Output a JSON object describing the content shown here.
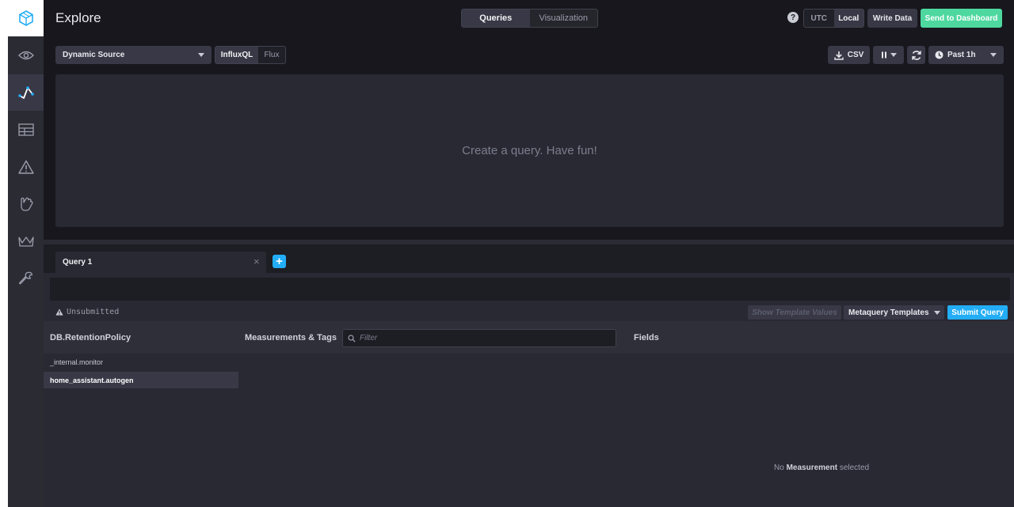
{
  "app": {
    "title": "Explore"
  },
  "sidebar": {
    "items": [
      {
        "name": "eye-icon",
        "active": false
      },
      {
        "name": "graph-icon",
        "active": true
      },
      {
        "name": "dashboard-icon",
        "active": false
      },
      {
        "name": "alert-icon",
        "active": false
      },
      {
        "name": "hand-icon",
        "active": false
      },
      {
        "name": "crown-icon",
        "active": false
      },
      {
        "name": "wrench-icon",
        "active": false
      }
    ]
  },
  "header": {
    "view_tabs": [
      "Queries",
      "Visualization"
    ],
    "active_view": "Queries",
    "help": "?",
    "timezone": [
      "UTC",
      "Local"
    ],
    "active_timezone": "Local",
    "write_data": "Write Data",
    "send_to_dashboard": "Send to Dashboard"
  },
  "toolbar": {
    "source": "Dynamic Source",
    "languages": [
      "InfluxQL",
      "Flux"
    ],
    "active_language": "InfluxQL",
    "csv": "CSV",
    "time_range": "Past 1h"
  },
  "graph": {
    "empty_message": "Create a query. Have fun!"
  },
  "query": {
    "tab_label": "Query 1",
    "close": "×",
    "add": "+",
    "status": "Unsubmitted",
    "show_template_values": "Show Template Values",
    "metaquery_templates": "Metaquery Templates",
    "submit": "Submit Query"
  },
  "schema": {
    "db_header": "DB.RetentionPolicy",
    "measurements_header": "Measurements & Tags",
    "filter_placeholder": "Filter",
    "fields_header": "Fields",
    "databases": [
      "_internal.monitor",
      "home_assistant.autogen"
    ],
    "selected_database": "home_assistant.autogen",
    "no_measurement_prefix": "No",
    "no_measurement_bold": "Measurement",
    "no_measurement_suffix": "selected"
  },
  "colors": {
    "accent_blue": "#22adf6",
    "accent_green": "#4ed8a0",
    "background": "#292933"
  }
}
